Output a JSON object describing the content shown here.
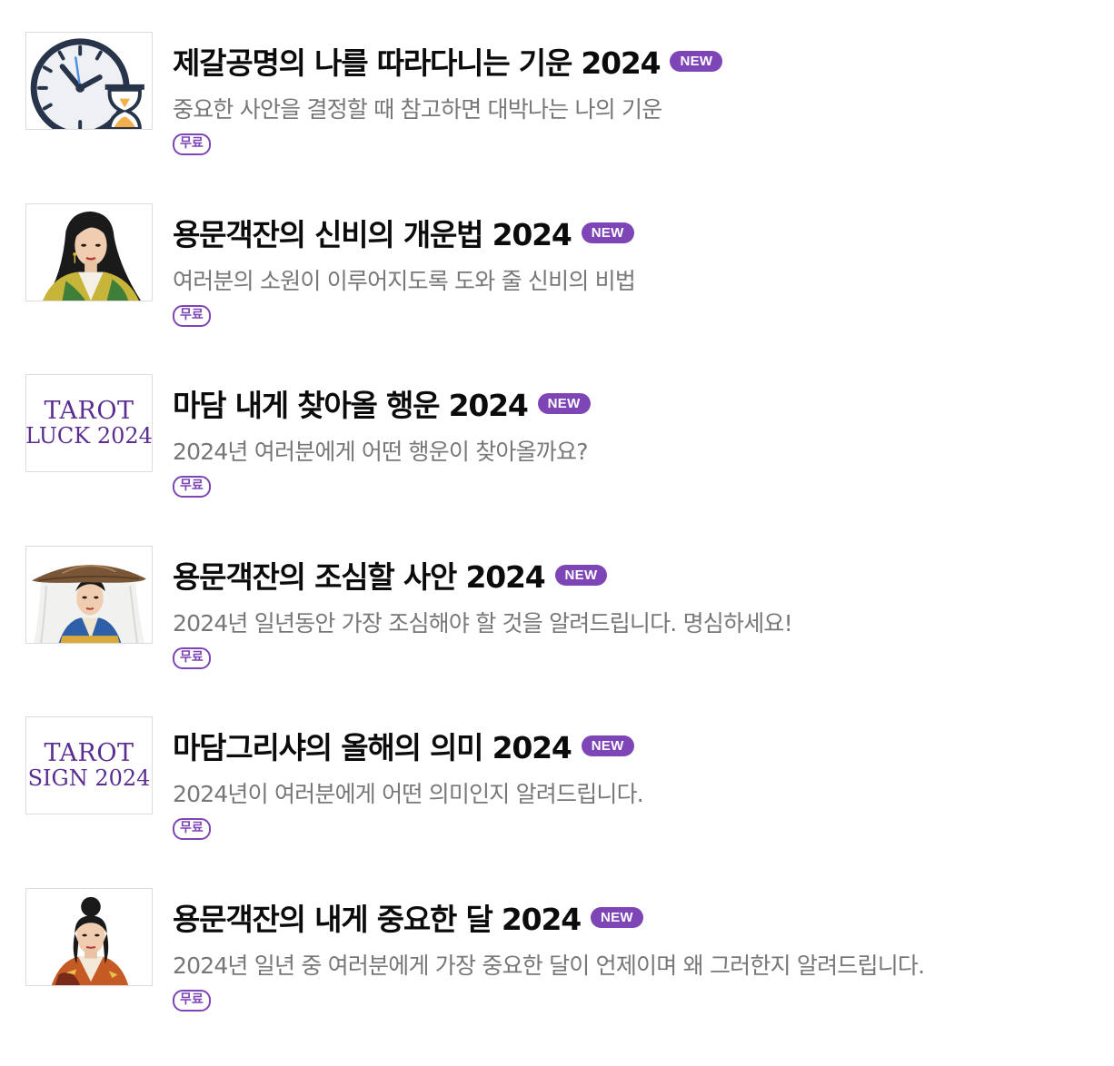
{
  "items": [
    {
      "thumb_icon": "clock-hourglass-icon",
      "title": "제갈공명의 나를 따라다니는 기운 2024",
      "new_badge": "NEW",
      "description": "중요한 사안을 결정할 때 참고하면 대박나는 나의 기운",
      "price_badge": "무료"
    },
    {
      "thumb_icon": "woman-portrait-icon",
      "title": "용문객잔의 신비의 개운법 2024",
      "new_badge": "NEW",
      "description": "여러분의 소원이 이루어지도록 도와 줄 신비의 비법",
      "price_badge": "무료"
    },
    {
      "thumb_icon": "tarot-luck-logo",
      "thumb_text": [
        "TAROT",
        "LUCK 2024"
      ],
      "title": "마담 내게 찾아올 행운 2024",
      "new_badge": "NEW",
      "description": "2024년 여러분에게 어떤 행운이 찾아올까요?",
      "price_badge": "무료"
    },
    {
      "thumb_icon": "woman-hat-portrait-icon",
      "title": "용문객잔의 조심할 사안 2024",
      "new_badge": "NEW",
      "description": "2024년 일년동안 가장 조심해야 할 것을 알려드립니다. 명심하세요!",
      "price_badge": "무료"
    },
    {
      "thumb_icon": "tarot-sign-logo",
      "thumb_text": [
        "TAROT",
        "SIGN 2024"
      ],
      "title": "마담그리샤의 올해의 의미 2024",
      "new_badge": "NEW",
      "description": "2024년이 여러분에게 어떤 의미인지 알려드립니다.",
      "price_badge": "무료"
    },
    {
      "thumb_icon": "man-topknot-portrait-icon",
      "title": "용문객잔의 내게 중요한 달 2024",
      "new_badge": "NEW",
      "description": "2024년 일년 중 여러분에게 가장 중요한 달이 언제이며 왜 그러한지 알려드립니다.",
      "price_badge": "무료"
    }
  ],
  "colors": {
    "accent_purple": "#7d45b6",
    "title_text": "#0b0b0b",
    "description_text": "#777777",
    "thumb_border": "#dcdcdc"
  }
}
